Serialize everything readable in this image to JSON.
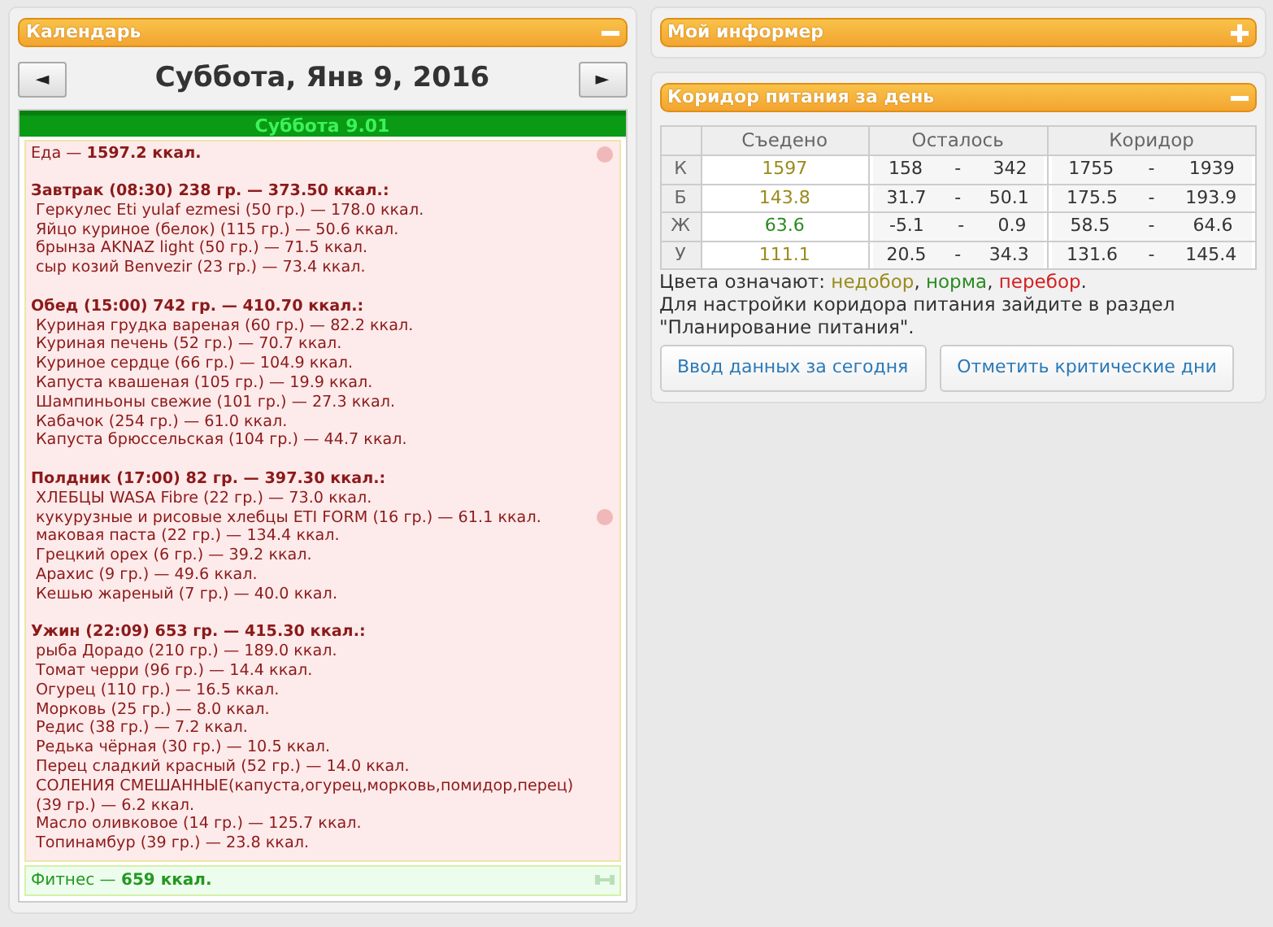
{
  "calendar": {
    "title": "Календарь",
    "expanded": true,
    "prev": "◄",
    "next": "►",
    "date": "Суббота, Янв 9, 2016",
    "day_bar": "Суббота 9.01",
    "food_total": "Еда — **1597.2 ккал.**",
    "meals": [
      {
        "title": "Завтрак (08:30) 238 гр. — 373.50 ккал.:",
        "items": [
          "Геркулес Eti yulaf ezmesi (50 гр.) — 178.0 ккал.",
          "Яйцо куриное (белок) (115 гр.) — 50.6 ккал.",
          "брынза AKNAZ light (50 гр.) — 71.5 ккал.",
          "сыр козий Benvezir (23 гр.) — 73.4 ккал."
        ]
      },
      {
        "title": "Обед (15:00) 742 гр. — 410.70 ккал.:",
        "items": [
          "Куриная грудка вареная (60 гр.) — 82.2 ккал.",
          "Куриная печень (52 гр.) — 70.7 ккал.",
          "Куриное сердце (66 гр.) — 104.9 ккал.",
          "Капуста квашеная (105 гр.) — 19.9 ккал.",
          "Шампиньоны свежие (101 гр.) — 27.3 ккал.",
          "Кабачок (254 гр.) — 61.0 ккал.",
          "Капуста брюссельская (104 гр.) — 44.7 ккал."
        ]
      },
      {
        "title": "Полдник (17:00) 82 гр. — 397.30 ккал.:",
        "items": [
          "ХЛЕБЦЫ WASA Fibre (22 гр.) — 73.0 ккал.",
          "кукурузные и рисовые хлебцы ETI FORM (16 гр.) — 61.1 ккал.",
          "маковая паста (22 гр.) — 134.4 ккал.",
          "Грецкий орех (6 гр.) — 39.2 ккал.",
          "Арахис (9 гр.) — 49.6 ккал.",
          "Кешью жареный (7 гр.) — 40.0 ккал."
        ]
      },
      {
        "title": "Ужин (22:09) 653 гр. — 415.30 ккал.:",
        "items": [
          "рыба Дорадо (210 гр.) — 189.0 ккал.",
          "Томат черри (96 гр.) — 14.4 ккал.",
          "Огурец (110 гр.) — 16.5 ккал.",
          "Морковь (25 гр.) — 8.0 ккал.",
          "Редис (38 гр.) — 7.2 ккал.",
          "Редька чёрная (30 гр.) — 10.5 ккал.",
          "Перец сладкий красный (52 гр.) — 14.0 ккал.",
          "СОЛЕНИЯ СМЕШАННЫЕ(капуста,огурец,морковь,помидор,перец) (39 гр.) — 6.2 ккал.",
          "Масло оливковое (14 гр.) — 125.7 ккал.",
          "Топинамбур (39 гр.) — 23.8 ккал."
        ]
      }
    ],
    "fitness": "Фитнес — **659 ккал.**"
  },
  "informer": {
    "title": "Мой информер",
    "expanded": false
  },
  "corridor": {
    "title": "Коридор питания за день",
    "expanded": true,
    "columns": [
      "Съедено",
      "Осталось",
      "Коридор"
    ],
    "rows": [
      {
        "label": "К",
        "eaten": "1597",
        "color": "#9a8b1c",
        "remaining": [
          "158",
          "-",
          "342"
        ],
        "range": [
          "1755",
          "-",
          "1939"
        ]
      },
      {
        "label": "Б",
        "eaten": "143.8",
        "color": "#9a8b1c",
        "remaining": [
          "31.7",
          "-",
          "50.1"
        ],
        "range": [
          "175.5",
          "-",
          "193.9"
        ]
      },
      {
        "label": "Ж",
        "eaten": "63.6",
        "color": "#2b8a22",
        "remaining": [
          "-5.1",
          "-",
          "0.9"
        ],
        "range": [
          "58.5",
          "-",
          "64.6"
        ]
      },
      {
        "label": "У",
        "eaten": "111.1",
        "color": "#9a8b1c",
        "remaining": [
          "20.5",
          "-",
          "34.3"
        ],
        "range": [
          "131.6",
          "-",
          "145.4"
        ]
      }
    ],
    "legend": {
      "prefix": "Цвета означают: ",
      "items": [
        {
          "text": "недобор",
          "color": "#9a8b1c"
        },
        {
          "text": "норма",
          "color": "#2b8a22"
        },
        {
          "text": "перебор",
          "color": "#d42020"
        }
      ],
      "separator": ", ",
      "end": "."
    },
    "note": "Для настройки коридора питания зайдите в раздел \"Планирование питания\".",
    "buttons": [
      "Ввод данных за сегодня",
      "Отметить критические дни"
    ]
  }
}
